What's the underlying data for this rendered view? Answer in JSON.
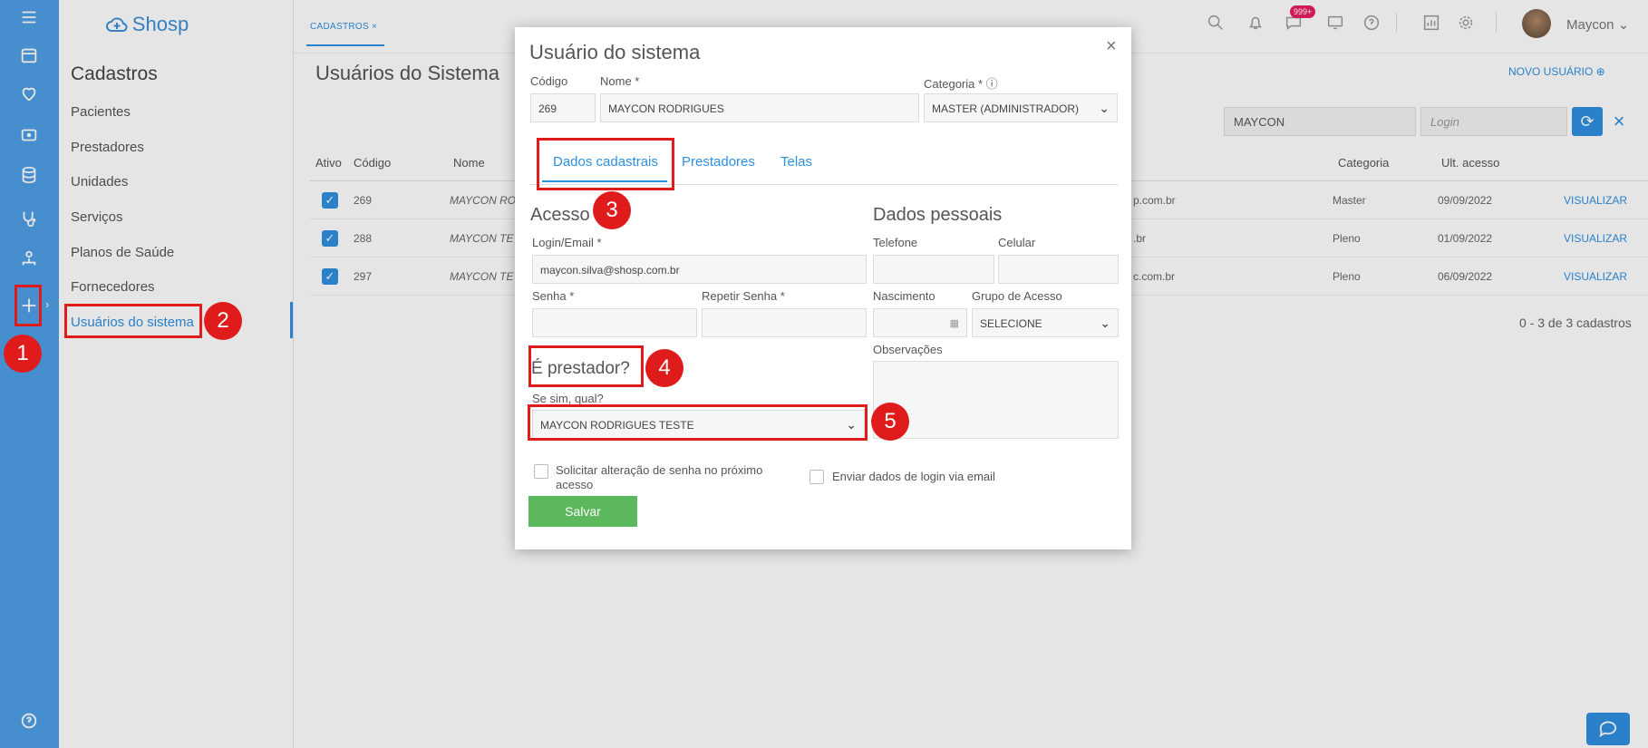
{
  "brand": {
    "name": "Shosp"
  },
  "sidebar": {
    "title": "Cadastros",
    "items": [
      {
        "label": "Pacientes"
      },
      {
        "label": "Prestadores"
      },
      {
        "label": "Unidades"
      },
      {
        "label": "Serviços"
      },
      {
        "label": "Planos de Saúde"
      },
      {
        "label": "Fornecedores"
      },
      {
        "label": "Usuários do sistema"
      }
    ]
  },
  "rail_icons": [
    "menu-icon",
    "calendar-icon",
    "heart-icon",
    "money-icon",
    "database-icon",
    "stethoscope-icon",
    "user-network-icon",
    "plus-icon",
    "help-icon"
  ],
  "header": {
    "tab_label": "CADASTROS ×",
    "notification_badge": "999+",
    "user_name": "Maycon ⌄",
    "icons": [
      "search-icon",
      "bell-icon",
      "chat-bubble-icon",
      "monitor-icon",
      "help-icon",
      "chart-icon",
      "gear-icon"
    ]
  },
  "page": {
    "title": "Usuários do Sistema",
    "new_user_label": "NOVO USUÁRIO ⊕",
    "filter_name_value": "MAYCON",
    "filter_login_placeholder": "Login",
    "pager_text": "0 - 3 de 3 cadastros"
  },
  "table": {
    "headers": {
      "ativo": "Ativo",
      "codigo": "Código",
      "nome": "Nome",
      "categoria": "Categoria",
      "ult_acesso": "Ult. acesso"
    },
    "rows": [
      {
        "codigo": "269",
        "nome": "MAYCON RO",
        "email_tail": "p.com.br",
        "categoria": "Master",
        "ult_acesso": "09/09/2022",
        "action": "VISUALIZAR"
      },
      {
        "codigo": "288",
        "nome": "MAYCON TE",
        "email_tail": ".br",
        "categoria": "Pleno",
        "ult_acesso": "01/09/2022",
        "action": "VISUALIZAR"
      },
      {
        "codigo": "297",
        "nome": "MAYCON TE",
        "email_tail": "c.com.br",
        "categoria": "Pleno",
        "ult_acesso": "06/09/2022",
        "action": "VISUALIZAR"
      }
    ]
  },
  "modal": {
    "title": "Usuário do sistema",
    "close": "×",
    "codigo_label": "Código",
    "codigo_value": "269",
    "nome_label": "Nome *",
    "nome_value": "MAYCON RODRIGUES",
    "categoria_label": "Categoria * ⓘ",
    "categoria_value": "MASTER (ADMINISTRADOR)",
    "tabs": [
      "Dados cadastrais",
      "Prestadores",
      "Telas"
    ],
    "acesso_title": "Acesso",
    "login_label": "Login/Email *",
    "login_value": "maycon.silva@shosp.com.br",
    "senha_label": "Senha *",
    "repetir_senha_label": "Repetir Senha *",
    "dados_pessoais_title": "Dados pessoais",
    "telefone_label": "Telefone",
    "celular_label": "Celular",
    "nascimento_label": "Nascimento",
    "grupo_acesso_label": "Grupo de Acesso",
    "grupo_acesso_value": "SELECIONE",
    "observacoes_label": "Observações",
    "e_prestador_title": "É prestador?",
    "se_sim_label": "Se sim, qual?",
    "prestador_value": "MAYCON RODRIGUES TESTE",
    "solicitar_label": "Solicitar alteração de senha no próximo acesso",
    "enviar_label": "Enviar dados de login via email",
    "salvar_label": "Salvar"
  },
  "annotations": [
    "1",
    "2",
    "3",
    "4",
    "5"
  ],
  "colors": {
    "primary": "#2f8fe0",
    "rail": "#4f9fe6",
    "save": "#5cb85c",
    "annotation": "#e01b1b"
  }
}
